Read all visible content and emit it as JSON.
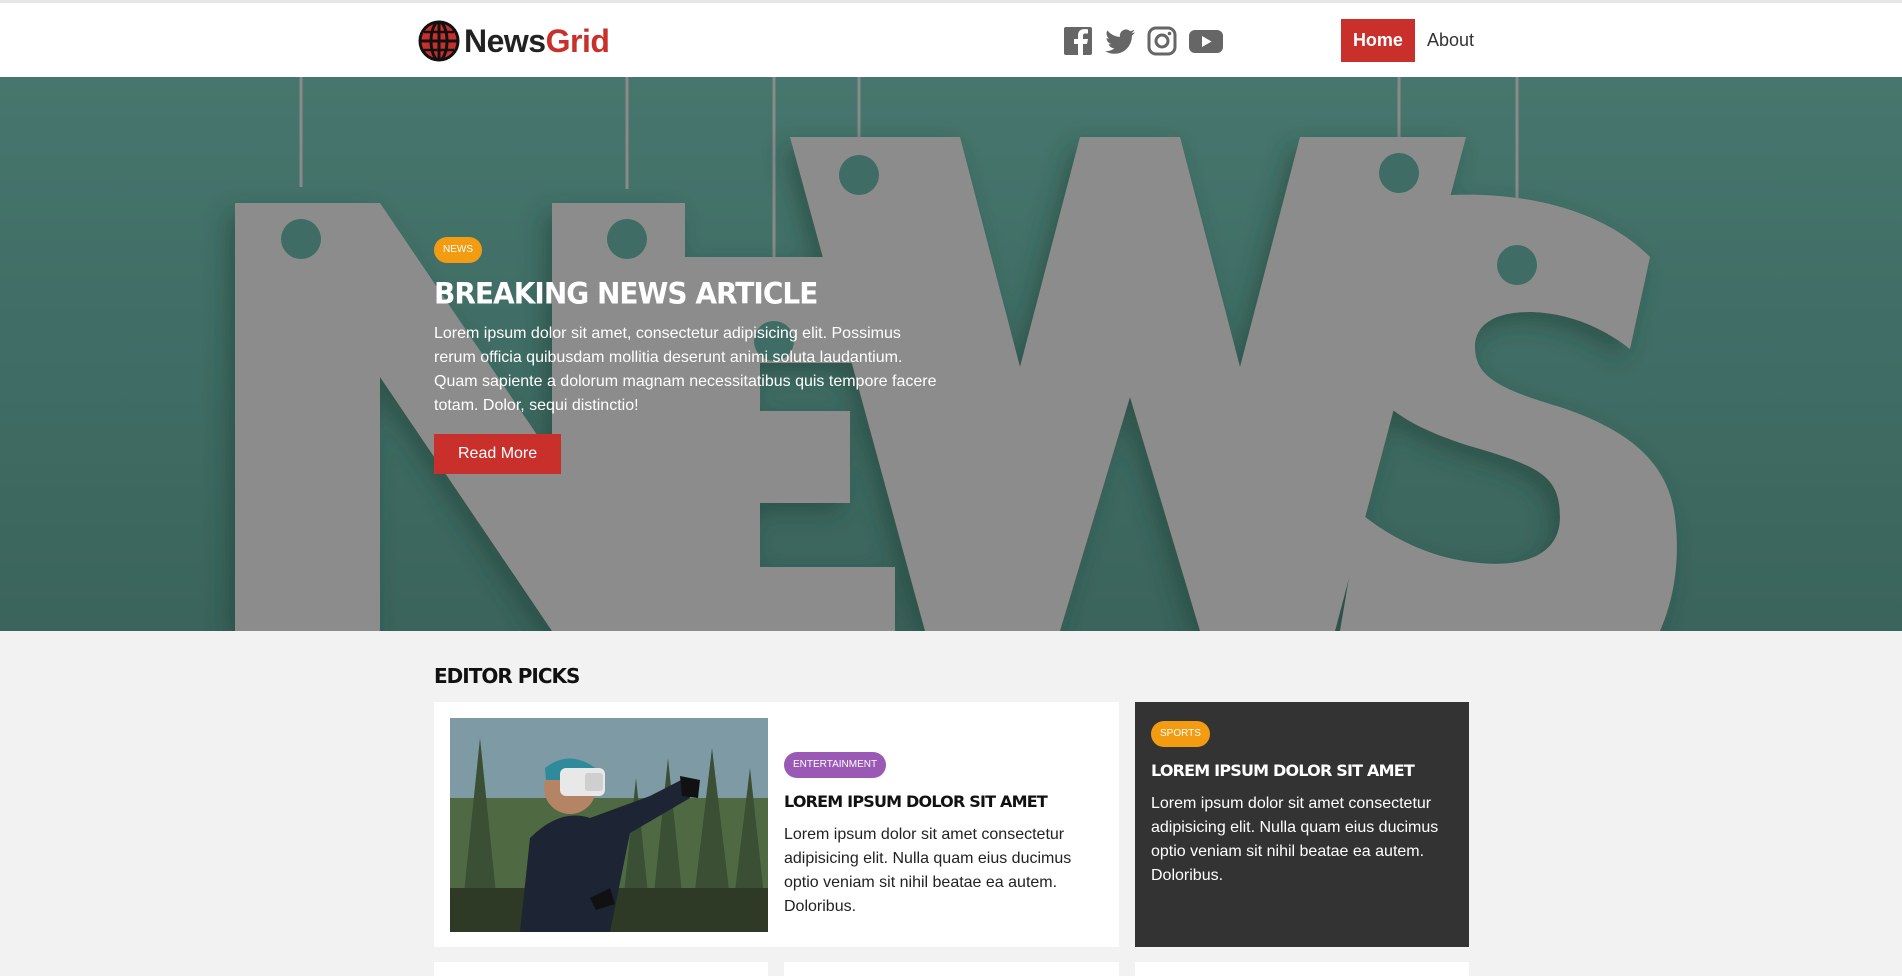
{
  "brand": {
    "part1": "News",
    "part2": "Grid"
  },
  "nav": {
    "home": "Home",
    "about": "About"
  },
  "social": [
    "facebook-icon",
    "twitter-icon",
    "instagram-icon",
    "youtube-icon"
  ],
  "colors": {
    "accent": "#c9302c",
    "news": "#f39c12",
    "entertainment": "#9b59b6",
    "dark": "#333333",
    "hero_bg": "#41706a"
  },
  "hero": {
    "badge": "NEWS",
    "title": "Breaking News Article",
    "text": "Lorem ipsum dolor sit amet, consectetur adipisicing elit. Possimus rerum officia quibusdam mollitia deserunt animi soluta laudantium. Quam sapiente a dolorum magnam necessitatibus quis tempore facere totam. Dolor, sequi distinctio!",
    "button": "Read More"
  },
  "editor_picks": {
    "title": "Editor Picks",
    "main": {
      "badge": "ENTERTAINMENT",
      "title": "Lorem ipsum dolor sit amet",
      "text": "Lorem ipsum dolor sit amet consectetur adipisicing elit. Nulla quam eius ducimus optio veniam sit nihil beatae ea autem. Doloribus."
    },
    "side": {
      "badge": "SPORTS",
      "title": "Lorem ipsum dolor sit amet",
      "text": "Lorem ipsum dolor sit amet consectetur adipisicing elit. Nulla quam eius ducimus optio veniam sit nihil beatae ea autem. Doloribus."
    }
  }
}
